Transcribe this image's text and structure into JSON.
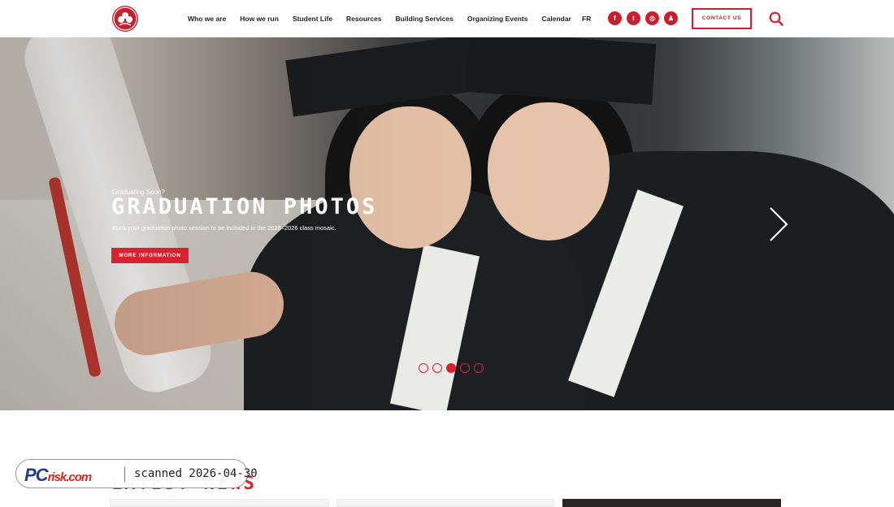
{
  "nav": {
    "items": [
      "Who we are",
      "How we run",
      "Student Life",
      "Resources",
      "Building Services",
      "Organizing Events",
      "Calendar"
    ],
    "lang": "FR",
    "social": [
      {
        "name": "facebook-icon",
        "glyph": "f"
      },
      {
        "name": "twitter-icon",
        "glyph": "t"
      },
      {
        "name": "instagram-icon",
        "glyph": "◎"
      },
      {
        "name": "snapchat-icon",
        "glyph": "♟"
      }
    ],
    "contact_label": "CONTACT US"
  },
  "hero": {
    "kicker": "Graduating Soon?",
    "title": "GRADUATION PHOTOS",
    "description": "Book your graduation photo session to be included in the 2025–2026 class mosaic.",
    "button_label": "MORE INFORMATION",
    "slides_total": 5,
    "active_slide": 3
  },
  "news": {
    "title": "LATEST NEWS"
  },
  "watermark": {
    "brand_pc": "PC",
    "brand_risk": "risk.com",
    "text": "scanned 2026-04-30"
  },
  "colors": {
    "accent": "#d9212f",
    "text": "#222222"
  }
}
